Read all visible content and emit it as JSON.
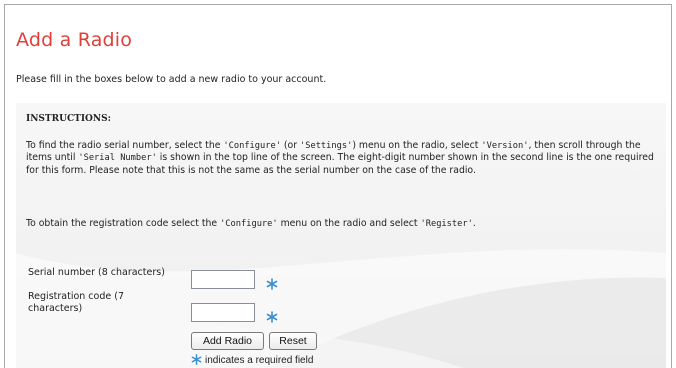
{
  "page": {
    "title": "Add a Radio",
    "intro": "Please fill in the boxes below to add a new radio to your account."
  },
  "instructions": {
    "heading": "INSTRUCTIONS:",
    "p1": {
      "t1": "To find the radio serial number, select the ",
      "c1": "'Configure'",
      "t2": " (or ",
      "c2": "'Settings'",
      "t3": ") menu on the radio, select ",
      "c3": "'Version'",
      "t4": ", then scroll through the items until ",
      "c4": "'Serial Number'",
      "t5": " is shown in the top line of the screen. The eight-digit number shown in the second line is the one required for this form. Please note that this is not the same as the serial number on the case of the radio."
    },
    "p2": {
      "t1": "To obtain the registration code select the ",
      "c1": "'Configure'",
      "t2": " menu on the radio and select ",
      "c2": "'Register'",
      "t3": "."
    }
  },
  "form": {
    "serial_label": "Serial number (8 characters)",
    "serial_value": "",
    "regcode_label": "Registration code (7 characters)",
    "regcode_value": "",
    "add_button": "Add Radio",
    "reset_button": "Reset",
    "required_note": "indicates a required field"
  },
  "icons": {
    "required": "required-asterisk-icon"
  },
  "colors": {
    "title": "#e0403a",
    "required_icon": "#3a8fd0"
  }
}
